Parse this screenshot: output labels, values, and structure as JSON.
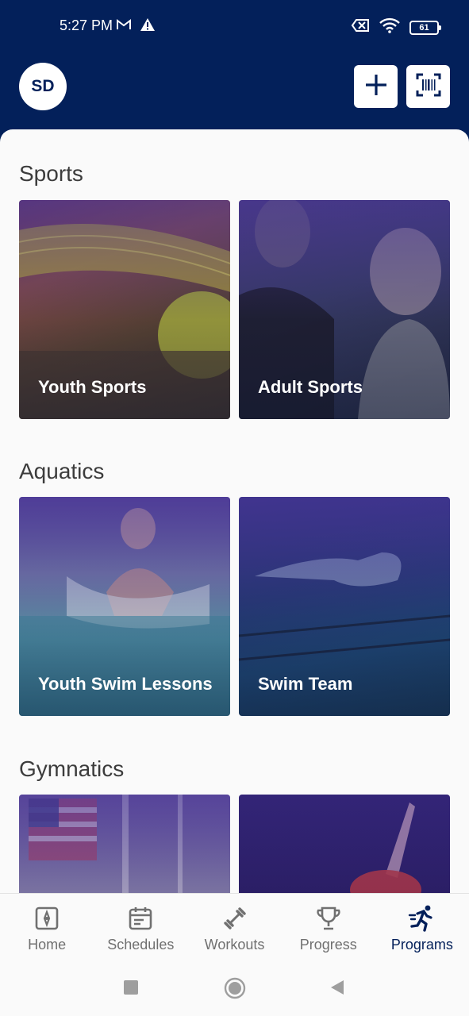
{
  "status_bar": {
    "time": "5:27 PM",
    "battery": "61",
    "icons": [
      "gmail-icon",
      "warning-icon",
      "no-sim-icon",
      "wifi-icon",
      "battery-icon"
    ]
  },
  "header": {
    "avatar_initials": "SD",
    "add_icon": "plus-icon",
    "scan_icon": "barcode-scan-icon"
  },
  "sections": [
    {
      "title": "Sports",
      "cards": [
        {
          "label": "Youth Sports"
        },
        {
          "label": "Adult Sports"
        }
      ]
    },
    {
      "title": "Aquatics",
      "cards": [
        {
          "label": "Youth Swim Lessons"
        },
        {
          "label": "Swim Team"
        }
      ]
    },
    {
      "title": "Gymnatics",
      "cards": [
        {
          "label": ""
        },
        {
          "label": ""
        }
      ]
    }
  ],
  "bottom_nav": {
    "items": [
      {
        "label": "Home",
        "icon": "home-icon",
        "active": false
      },
      {
        "label": "Schedules",
        "icon": "calendar-icon",
        "active": false
      },
      {
        "label": "Workouts",
        "icon": "dumbbell-icon",
        "active": false
      },
      {
        "label": "Progress",
        "icon": "trophy-icon",
        "active": false
      },
      {
        "label": "Programs",
        "icon": "running-icon",
        "active": true
      }
    ]
  },
  "colors": {
    "header_bg": "#03205a",
    "active_nav": "#03205a",
    "inactive_nav": "#707070"
  }
}
